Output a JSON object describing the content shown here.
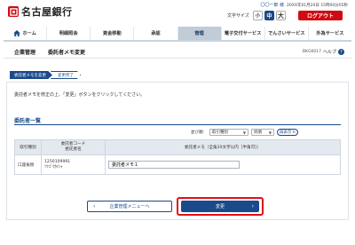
{
  "header": {
    "bank_name": "名古屋銀行",
    "user_name": "〇〇一郎 様",
    "last_login": "20XX年01月20日 15時00分05秒",
    "font_size_label": "文字サイズ",
    "font_sizes": [
      "小",
      "中",
      "大"
    ],
    "logout_label": "ログアウト"
  },
  "nav": {
    "items": [
      "ホーム",
      "明細照会",
      "資金移動",
      "承認",
      "管理",
      "電子交付サービス",
      "でんさいサービス",
      "外為サービス"
    ],
    "active_index": 4
  },
  "title": {
    "main": "企業管理",
    "sub": "委託者メモ変更",
    "screen_id": "BKGK017",
    "help_label": "ヘルプ"
  },
  "steps": [
    "委託者メモを変更",
    "変更完了"
  ],
  "instruction": "委託者メモを修正の上、「変更」ボタンをクリックしてください。",
  "section_title": "委託者一覧",
  "sort": {
    "label": "並び順：",
    "field": "取引種別",
    "order": "昇順",
    "resort_label": "再表示"
  },
  "table": {
    "headers": [
      "取引種別",
      "委託者コード\n委託者名",
      "委託者メモ（全角20文字以内［半角可］）"
    ],
    "rows": [
      {
        "type": "口座振替",
        "code": "1250109991",
        "name": "ｿｳｺﾞｳｶｲｼｬ",
        "memo": "委託者メモ１"
      }
    ]
  },
  "buttons": {
    "back": "企業管理メニューへ",
    "submit": "変更"
  },
  "colors": {
    "brand_red": "#d10a11",
    "primary_navy": "#1a4a8a",
    "nav_active": "#c0ccd8"
  }
}
